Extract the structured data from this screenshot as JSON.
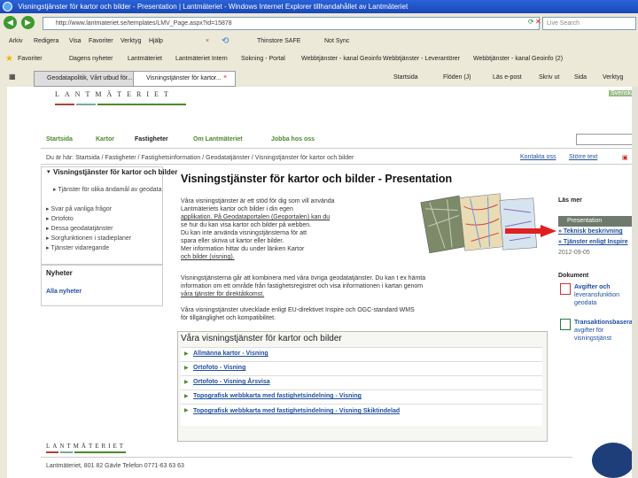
{
  "window": {
    "title": "Visningstjänster för kartor och bilder - Presentation | Lantmäteriet - Windows Internet Explorer tillhandahållet av Lantmäteriet"
  },
  "address": {
    "url": "http://www.lantmateriet.se/templates/LMV_Page.aspx?id=15878",
    "search_placeholder": "Live Search"
  },
  "menu": [
    "Arkiv",
    "Redigera",
    "Visa",
    "Favoriter",
    "Verktyg",
    "Hjälp"
  ],
  "toolbar_right": [
    "Thinstore SAFE",
    "Not Sync"
  ],
  "favorites_bar": {
    "label": "Favoriter",
    "items": [
      "Dagens nyheter",
      "Lantmäteriet",
      "Lantmäteriet Intern",
      "Sokning - Portal",
      "Webbtjänster - kanal Geoinfo",
      "Webbtjänster - Leverantörer",
      "Webbtjänster - kanal Geoinfo (2)"
    ]
  },
  "tabs": [
    {
      "label": "Geodatapolitik, Vårt utbud för..."
    },
    {
      "label": "Visningstjänster för kartor..."
    }
  ],
  "tab_tools": [
    "Startsida",
    "Flöden (J)",
    "Läs e-post",
    "Skriv ut",
    "Sida",
    "Verktyg"
  ],
  "site": {
    "logo": "LANTMÄTERIET",
    "lang": "Svenska",
    "nav": [
      "Startsida",
      "Kartor",
      "Fastigheter",
      "Om Lantmäteriet",
      "Jobba hos oss"
    ],
    "nav_active_index": 2,
    "breadcrumb": "Du är här: Startsida / Fastigheter / Fastighetsinformation / Geodatatjänster / Visningstjänster för kartor och bilder",
    "top_links": [
      "Kontakta oss",
      "Större text"
    ]
  },
  "leftmenu": {
    "title": "Visningstjänster för kartor och bilder",
    "items": [
      "Tjänster för olika ändamål av geodata",
      "Svar på vanliga frågor",
      "Ortofoto",
      "Dessa geodatatjänster",
      "Sorgfunktionen i stadieplaner",
      "Tjänster vidaregande"
    ],
    "news_title": "Nyheter",
    "news_link": "Alla nyheter"
  },
  "main": {
    "heading": "Visningstjänster för kartor och bilder - Presentation",
    "intro": [
      "Våra visningstjänster är ett stöd för dig som vill använda",
      "Lantmäteriets kartor och bilder i din egen",
      "applikation. På Geodataportalen (Geoportalen) kan du",
      "se hur du kan visa kartor och bilder på webben.",
      "Du kan inte använda visningstjänsterna för att",
      "spara eller skriva ut kartor eller bilder.",
      "Mer information hittar du under länken Kartor",
      "och bilder (visning)."
    ],
    "body": [
      "Visningstjänsterna går att kombinera med våra övriga geodatatjänster. Du kan t ex hämta",
      "information om ett område från fastighetsregistret och visa informationen i kartan genom",
      "våra tjänster för direktåtkomst.",
      "Våra visningstjänster utvecklade enligt EU-direktivet Inspire och OGC-standard WMS",
      "för tillgänglighet och kompatibilitet."
    ],
    "services_title": "Våra visningstjänster för kartor och bilder",
    "services": [
      "Allmänna kartor - Visning",
      "Ortofoto - Visning",
      "Ortofoto - Visning Årsvisa",
      "Topografisk webbkarta med fastighetsindelning - Visning",
      "Topografisk webbkarta med fastighetsindelning - Visning Skiktindelad"
    ]
  },
  "rightcol": {
    "read_more": "Läs mer",
    "active_tab": "Presentation",
    "links": [
      "Teknisk beskrivning",
      "Tjänster enligt Inspire"
    ],
    "date": "2012-09-05",
    "doc_head": "Dokument",
    "docs": [
      [
        "Avgifter och",
        "leveransfunktion",
        "geodata"
      ],
      [
        "Transaktionsbaserade",
        "avgifter för",
        "visningstjänst"
      ]
    ]
  },
  "footer": {
    "logo": "LANTMÄTERIET",
    "address": "Lantmäteriet, 801 82 Gävle  Telefon 0771-63 63 63"
  },
  "colors": {
    "titlebar": "#1a48b8",
    "chrome": "#ece9d8",
    "link": "#1f4fa0",
    "nav_green": "#4a8a2a",
    "arrow_red": "#e02020"
  }
}
